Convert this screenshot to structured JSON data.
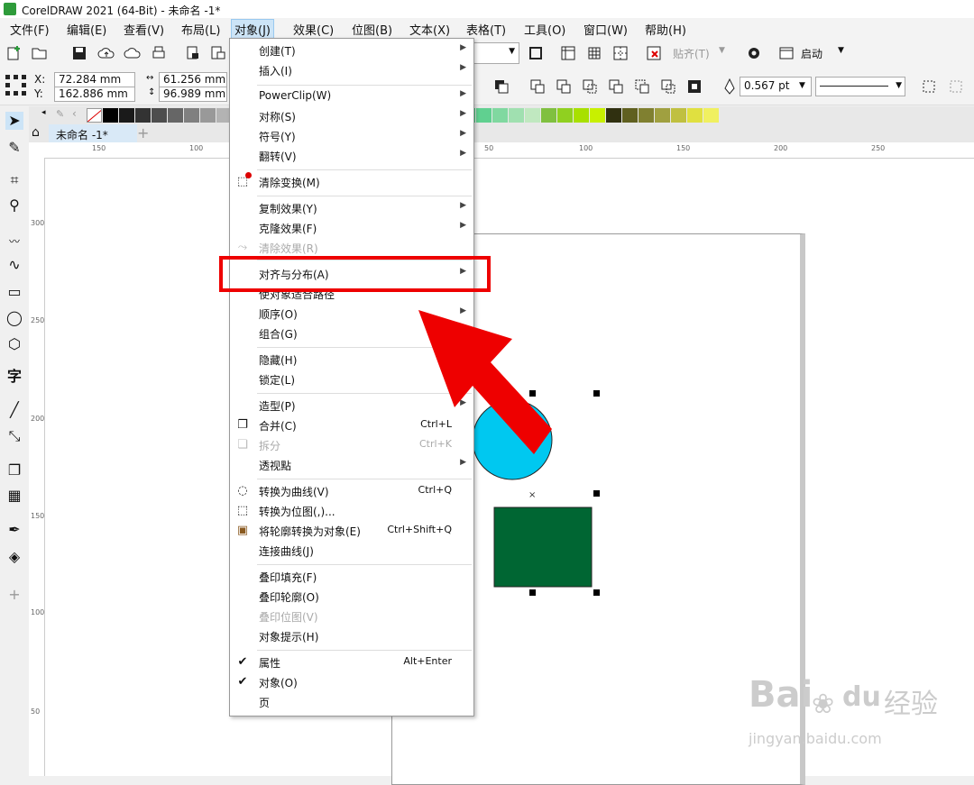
{
  "title_bar": {
    "title": "CorelDRAW 2021 (64-Bit) - 未命名 -1*"
  },
  "menubar": {
    "items": [
      "文件(F)",
      "编辑(E)",
      "查看(V)",
      "布局(L)",
      "对象(J)",
      "效果(C)",
      "位图(B)",
      "文本(X)",
      "表格(T)",
      "工具(O)",
      "窗口(W)",
      "帮助(H)"
    ],
    "active_index": 4
  },
  "toolbar": {
    "snap_label": "贴齐(T)",
    "launch_label": "启动"
  },
  "property_bar": {
    "x_label": "X:",
    "y_label": "Y:",
    "x_value": "72.284 mm",
    "y_value": "162.886 mm",
    "width_value": "61.256 mm",
    "height_value": "96.989 mm",
    "outline_width": "0.567 pt"
  },
  "document_tab": {
    "label": "未命名 -1*"
  },
  "h_ruler_labels": [
    "150",
    "100",
    "50",
    "100",
    "150",
    "200",
    "250"
  ],
  "v_ruler_labels": [
    "300",
    "250",
    "200",
    "150",
    "100",
    "50"
  ],
  "palette_colors": [
    "#000000",
    "#1a1a1a",
    "#333333",
    "#4d4d4d",
    "#666666",
    "#808080",
    "#999999",
    "#b3b3b3",
    "#6a6ad8",
    "#3f3fc8",
    "#2030a0",
    "#0050d0",
    "#00a0e8",
    "#00c8f0",
    "#7ed8e0",
    "#9ad0c8",
    "#50a8a0",
    "#306860",
    "#006030",
    "#00a040",
    "#20b050",
    "#30c060",
    "#40c878",
    "#60d090",
    "#80d8a0",
    "#a0e0b0",
    "#c0e8c0",
    "#80c040",
    "#90d020",
    "#a8e000",
    "#c8f000",
    "#303010",
    "#606020",
    "#808030",
    "#a0a040",
    "#c0c040",
    "#e0e040",
    "#f0f060"
  ],
  "object_menu": {
    "items": [
      {
        "label": "创建(T)",
        "submenu": true
      },
      {
        "label": "插入(I)",
        "submenu": true
      },
      {
        "label": "PowerClip(W)",
        "submenu": true
      },
      {
        "label": "对称(S)",
        "submenu": true
      },
      {
        "label": "符号(Y)",
        "submenu": true
      },
      {
        "label": "翻转(V)",
        "submenu": true
      },
      {
        "label": "清除变换(M)",
        "icon": "clear-transform-icon"
      },
      {
        "label": "复制效果(Y)",
        "submenu": true
      },
      {
        "label": "克隆效果(F)",
        "submenu": true
      },
      {
        "label": "清除效果(R)",
        "disabled": true,
        "icon": "clear-effect-icon"
      },
      {
        "label": "对齐与分布(A)",
        "submenu": true
      },
      {
        "label": "使对象适合路径"
      },
      {
        "label": "顺序(O)",
        "submenu": true
      },
      {
        "label": "组合(G)",
        "submenu": true
      },
      {
        "label": "隐藏(H)"
      },
      {
        "label": "锁定(L)"
      },
      {
        "label": "造型(P)",
        "submenu": true
      },
      {
        "label": "合并(C)",
        "shortcut": "Ctrl+L",
        "icon": "combine-icon"
      },
      {
        "label": "拆分",
        "shortcut": "Ctrl+K",
        "disabled": true,
        "icon": "break-apart-icon"
      },
      {
        "label": "透视點",
        "submenu": true
      },
      {
        "label": "转换为曲线(V)",
        "shortcut": "Ctrl+Q",
        "icon": "convert-curves-icon"
      },
      {
        "label": "转换为位图(,)...",
        "icon": "convert-bitmap-icon"
      },
      {
        "label": "将轮廓转换为对象(E)",
        "shortcut": "Ctrl+Shift+Q",
        "icon": "outline-to-object-icon"
      },
      {
        "label": "连接曲线(J)"
      },
      {
        "label": "叠印填充(F)"
      },
      {
        "label": "叠印轮廓(O)"
      },
      {
        "label": "叠印位图(V)",
        "disabled": true
      },
      {
        "label": "对象提示(H)"
      },
      {
        "label": "属性",
        "shortcut": "Alt+Enter",
        "checked": true
      },
      {
        "label": "对象(O)",
        "checked": true
      },
      {
        "label": "页"
      }
    ]
  },
  "canvas": {
    "circle_color": "#00c8f0",
    "rect_color": "#006633"
  },
  "annotation": {
    "highlight_color": "#e00000",
    "arrow_color": "#ee0000"
  },
  "watermark": {
    "brand": "Bai",
    "brand2": "du",
    "brand_cn": "经验",
    "url": "jingyan.baidu.com"
  }
}
